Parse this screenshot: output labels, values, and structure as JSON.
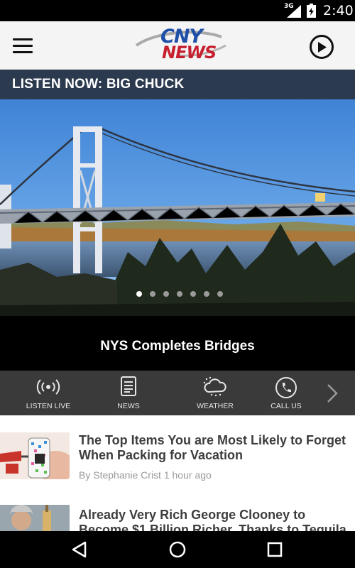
{
  "status_bar": {
    "network": "3G",
    "time": "2:40",
    "icons": [
      "signal-icon",
      "battery-icon"
    ]
  },
  "header": {
    "logo_line1": "CNY",
    "logo_line2": "NEWS",
    "menu_icon": "hamburger-menu-icon",
    "play_icon": "play-circle-icon"
  },
  "listen_now": {
    "label": "LISTEN NOW: BIG CHUCK"
  },
  "carousel": {
    "headline": "NYS Completes Bridges",
    "slide_count": 7,
    "active_slide": 1
  },
  "shortcuts": {
    "items": [
      {
        "label": "LISTEN LIVE",
        "icon": "broadcast-icon"
      },
      {
        "label": "NEWS",
        "icon": "newspaper-icon"
      },
      {
        "label": "WEATHER",
        "icon": "weather-cloud-icon"
      },
      {
        "label": "CALL US",
        "icon": "phone-icon"
      }
    ],
    "next_icon": "chevron-right-icon"
  },
  "articles": [
    {
      "title": "The Top Items You are Most Likely to Forget When Packing for Vacation",
      "author": "By Stephanie Crist",
      "time": "1 hour ago"
    },
    {
      "title": "Already Very Rich George Clooney to Become $1 Billion Richer, Thanks to Tequila"
    }
  ],
  "nav_bar": {
    "icons": [
      "back-icon",
      "home-icon",
      "recents-icon"
    ]
  },
  "colors": {
    "listen_bar_bg": "#2b3a4e",
    "shortcut_bg": "#3a3a3a",
    "logo_blue": "#1f4fa6",
    "logo_red": "#c6202f"
  }
}
